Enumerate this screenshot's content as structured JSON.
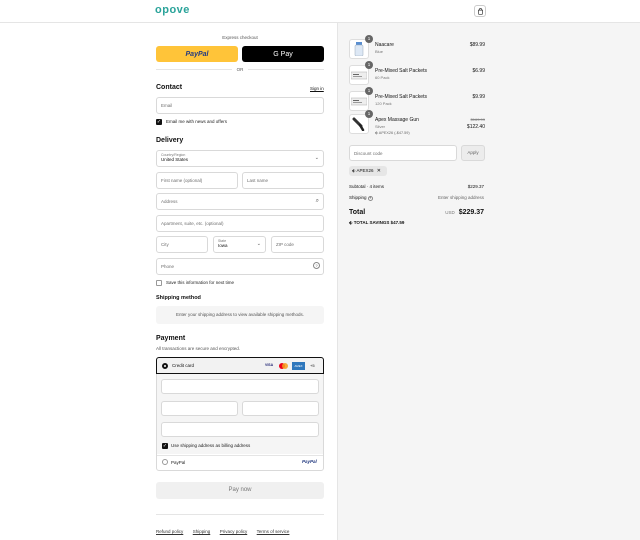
{
  "header": {
    "logo": "opove",
    "cart_icon": "shopping-bag-icon"
  },
  "express": {
    "title": "Express checkout",
    "paypal": "PayPal",
    "gpay": "G Pay",
    "or": "OR"
  },
  "contact": {
    "title": "Contact",
    "sign_in": "Sign in",
    "email_placeholder": "Email",
    "news_label": "Email me with news and offers",
    "news_checked": true
  },
  "delivery": {
    "title": "Delivery",
    "country_label": "Country/Region",
    "country_value": "United States",
    "first_name": "First name (optional)",
    "last_name": "Last name",
    "address": "Address",
    "apartment": "Apartment, suite, etc. (optional)",
    "city": "City",
    "state_label": "State",
    "state_value": "Iowa",
    "zip": "ZIP code",
    "phone": "Phone",
    "save_label": "Save this information for next time"
  },
  "shipping": {
    "title": "Shipping method",
    "note": "Enter your shipping address to view available shipping methods."
  },
  "payment": {
    "title": "Payment",
    "subtitle": "All transactions are secure and encrypted.",
    "credit_label": "Credit card",
    "card_brands": [
      "VISA",
      "MC",
      "AMEX"
    ],
    "more_cards": "+5",
    "billing_label": "Use shipping address as billing address",
    "paypal_label": "PayPal",
    "paypal_logo": "PayPal",
    "pay_now": "Pay now"
  },
  "footer": {
    "links": [
      "Refund policy",
      "Shipping",
      "Privacy policy",
      "Terms of service"
    ]
  },
  "order": {
    "items": [
      {
        "qty": "1",
        "name": "Naacare",
        "sub": "Blue",
        "price": "$89.99"
      },
      {
        "qty": "1",
        "name": "Pre-Mixed Salt Packets",
        "sub": "60 Pack",
        "price": "$6.99"
      },
      {
        "qty": "1",
        "name": "Pre-Mixed Salt Packets",
        "sub": "120 Pack",
        "price": "$9.99"
      },
      {
        "qty": "1",
        "name": "Apex Massage Gun",
        "sub": "Silver",
        "discount": "APEX26 (-$47.59)",
        "old_price": "$169.99",
        "price": "$122.40"
      }
    ],
    "discount_placeholder": "Discount code",
    "apply": "Apply",
    "applied_code": "APEX26",
    "subtotal_label": "Subtotal · 4 items",
    "subtotal_value": "$229.37",
    "shipping_label": "Shipping",
    "shipping_value": "Enter shipping address",
    "total_label": "Total",
    "currency": "USD",
    "total_value": "$229.37",
    "savings_label": "TOTAL SAVINGS",
    "savings_value": "$47.59"
  },
  "colors": {
    "brand": "#2aa39a",
    "paypal": "#ffc439",
    "gpay": "#000000"
  }
}
